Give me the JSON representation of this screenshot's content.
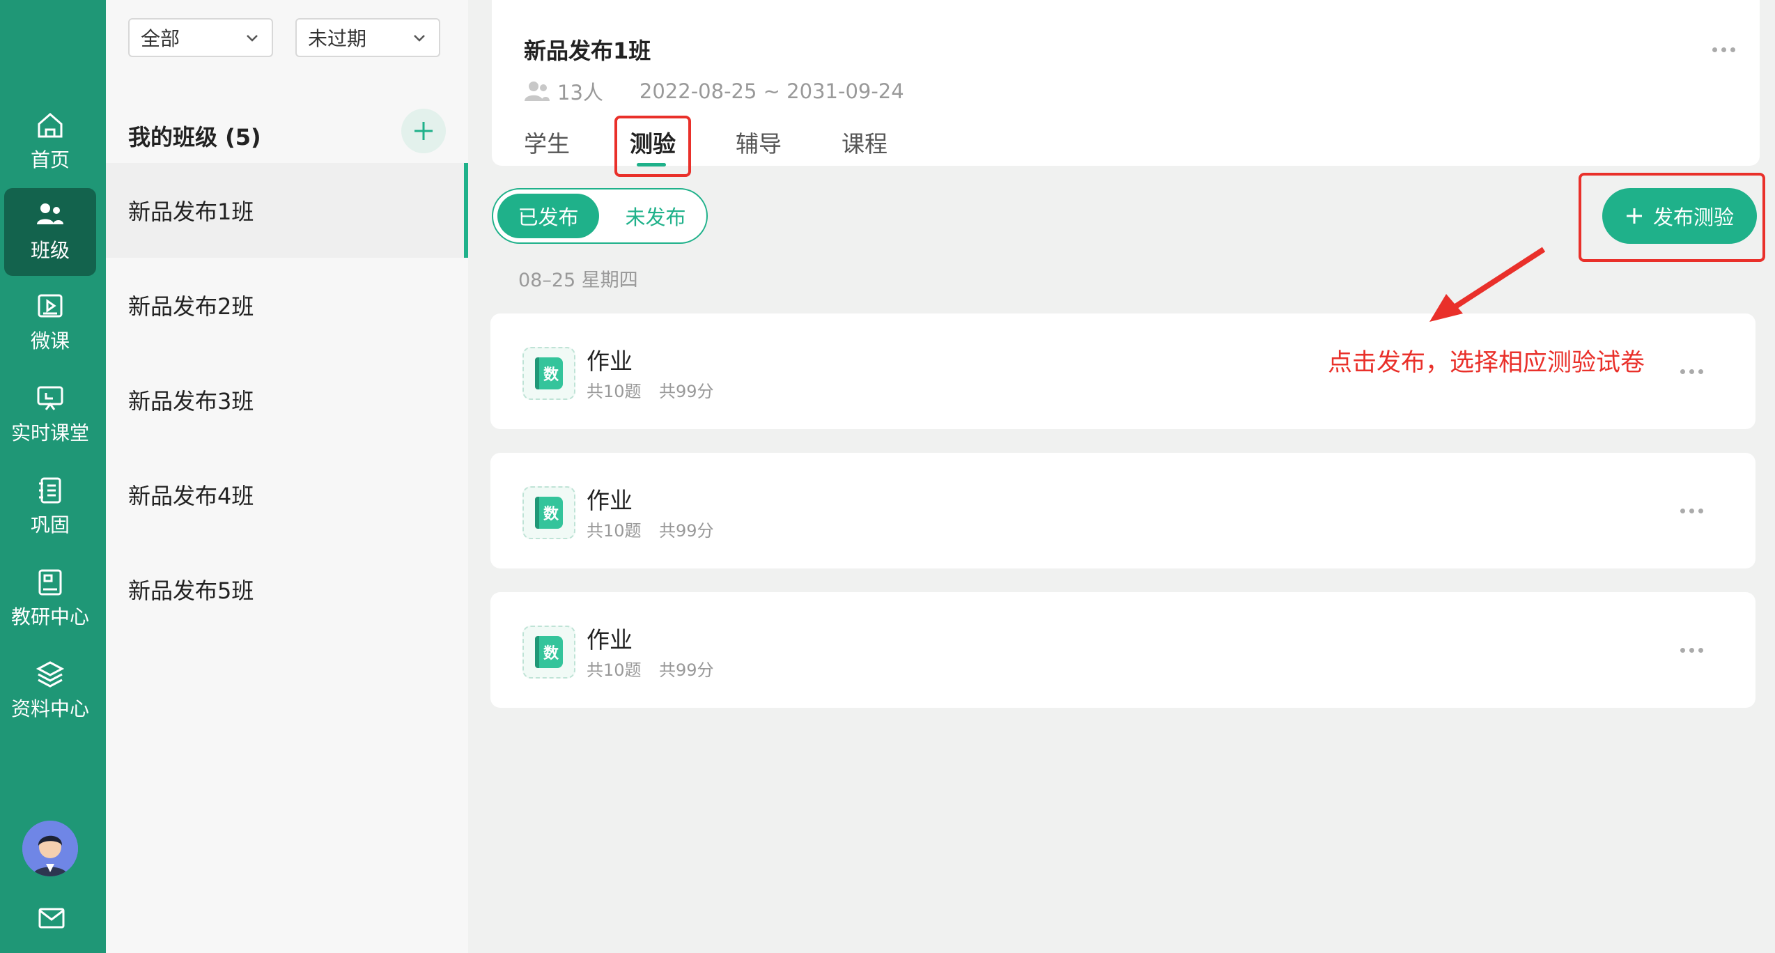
{
  "nav": {
    "items": [
      {
        "label": "首页",
        "icon": "home-icon"
      },
      {
        "label": "班级",
        "icon": "class-group-icon"
      },
      {
        "label": "微课",
        "icon": "video-icon"
      },
      {
        "label": "实时课堂",
        "icon": "live-class-icon"
      },
      {
        "label": "巩固",
        "icon": "notebook-icon"
      },
      {
        "label": "教研中心",
        "icon": "research-icon"
      },
      {
        "label": "资料中心",
        "icon": "layers-icon"
      }
    ],
    "active_index": 1,
    "bottom_icons": [
      "avatar",
      "mail-icon"
    ]
  },
  "filters": {
    "scope": {
      "value": "全部"
    },
    "status": {
      "value": "未过期"
    }
  },
  "class_list": {
    "title": "我的班级 (5)",
    "items": [
      "新品发布1班",
      "新品发布2班",
      "新品发布3班",
      "新品发布4班",
      "新品发布5班"
    ],
    "active_index": 0
  },
  "header": {
    "class_name": "新品发布1班",
    "member_count": "13人",
    "date_range": "2022-08-25 ~ 2031-09-24",
    "tabs": [
      "学生",
      "测验",
      "辅导",
      "课程"
    ],
    "active_tab_index": 1
  },
  "toggle": {
    "published": "已发布",
    "unpublished": "未发布"
  },
  "publish_button": {
    "label": "发布测验"
  },
  "date_group": "08–25 星期四",
  "quizzes": [
    {
      "badge": "数",
      "title": "作业",
      "questions": "共10题",
      "score": "共99分"
    },
    {
      "badge": "数",
      "title": "作业",
      "questions": "共10题",
      "score": "共99分"
    },
    {
      "badge": "数",
      "title": "作业",
      "questions": "共10题",
      "score": "共99分"
    }
  ],
  "annotation": {
    "text": "点击发布，选择相应测验试卷",
    "color": "#e9302a"
  },
  "colors": {
    "nav_bg": "#1f9776",
    "nav_active": "#13634d",
    "accent": "#1fb18a"
  }
}
